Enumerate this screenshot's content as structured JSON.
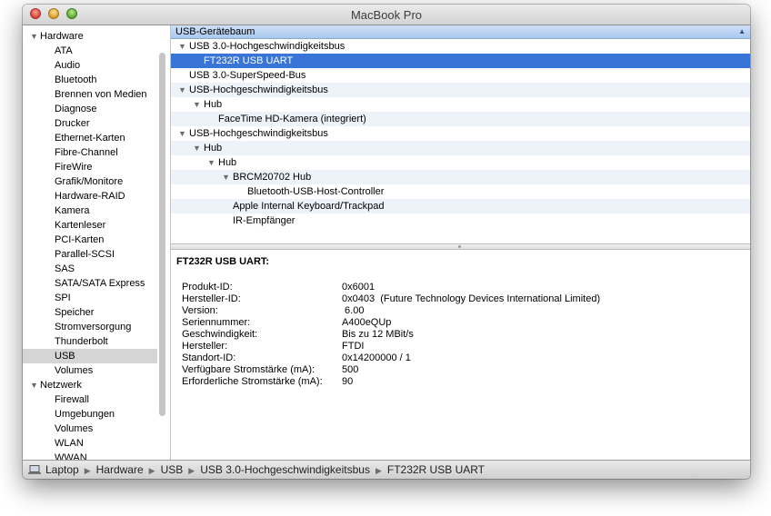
{
  "window": {
    "title": "MacBook Pro"
  },
  "sidebar": {
    "groups": [
      {
        "label": "Hardware",
        "items": [
          "ATA",
          "Audio",
          "Bluetooth",
          "Brennen von Medien",
          "Diagnose",
          "Drucker",
          "Ethernet-Karten",
          "Fibre-Channel",
          "FireWire",
          "Grafik/Monitore",
          "Hardware-RAID",
          "Kamera",
          "Kartenleser",
          "PCI-Karten",
          "Parallel-SCSI",
          "SAS",
          "SATA/SATA Express",
          "SPI",
          "Speicher",
          "Stromversorgung",
          "Thunderbolt",
          "USB",
          "Volumes"
        ]
      },
      {
        "label": "Netzwerk",
        "items": [
          "Firewall",
          "Umgebungen",
          "Volumes",
          "WLAN",
          "WWAN"
        ]
      }
    ],
    "selected": "USB"
  },
  "tree": {
    "header": "USB-Gerätebaum",
    "rows": [
      {
        "label": "USB 3.0-Hochgeschwindigkeitsbus",
        "level": 0,
        "expanded": true
      },
      {
        "label": "FT232R USB UART",
        "level": 1,
        "selected": true
      },
      {
        "label": "USB 3.0-SuperSpeed-Bus",
        "level": 0
      },
      {
        "label": "USB-Hochgeschwindigkeitsbus",
        "level": 0,
        "expanded": true
      },
      {
        "label": "Hub",
        "level": 1,
        "expanded": true
      },
      {
        "label": "FaceTime HD-Kamera (integriert)",
        "level": 2
      },
      {
        "label": "USB-Hochgeschwindigkeitsbus",
        "level": 0,
        "expanded": true
      },
      {
        "label": "Hub",
        "level": 1,
        "expanded": true
      },
      {
        "label": "Hub",
        "level": 2,
        "expanded": true
      },
      {
        "label": "BRCM20702 Hub",
        "level": 3,
        "expanded": true
      },
      {
        "label": "Bluetooth-USB-Host-Controller",
        "level": 4
      },
      {
        "label": "Apple Internal Keyboard/Trackpad",
        "level": 3
      },
      {
        "label": "IR-Empfänger",
        "level": 3
      }
    ]
  },
  "detail": {
    "title": "FT232R USB UART:",
    "properties": [
      {
        "label": "Produkt-ID:",
        "value": "0x6001"
      },
      {
        "label": "Hersteller-ID:",
        "value": "0x0403  (Future Technology Devices International Limited)"
      },
      {
        "label": "Version:",
        "value": " 6.00"
      },
      {
        "label": "Seriennummer:",
        "value": "A400eQUp"
      },
      {
        "label": "Geschwindigkeit:",
        "value": "Bis zu 12 MBit/s"
      },
      {
        "label": "Hersteller:",
        "value": "FTDI"
      },
      {
        "label": "Standort-ID:",
        "value": "0x14200000 / 1"
      },
      {
        "label": "Verfügbare Stromstärke (mA):",
        "value": "500"
      },
      {
        "label": "Erforderliche Stromstärke (mA):",
        "value": "90"
      }
    ]
  },
  "statusbar": {
    "icon": "laptop-icon",
    "breadcrumb": [
      "Laptop",
      "Hardware",
      "USB",
      "USB 3.0-Hochgeschwindigkeitsbus",
      "FT232R USB UART"
    ]
  }
}
